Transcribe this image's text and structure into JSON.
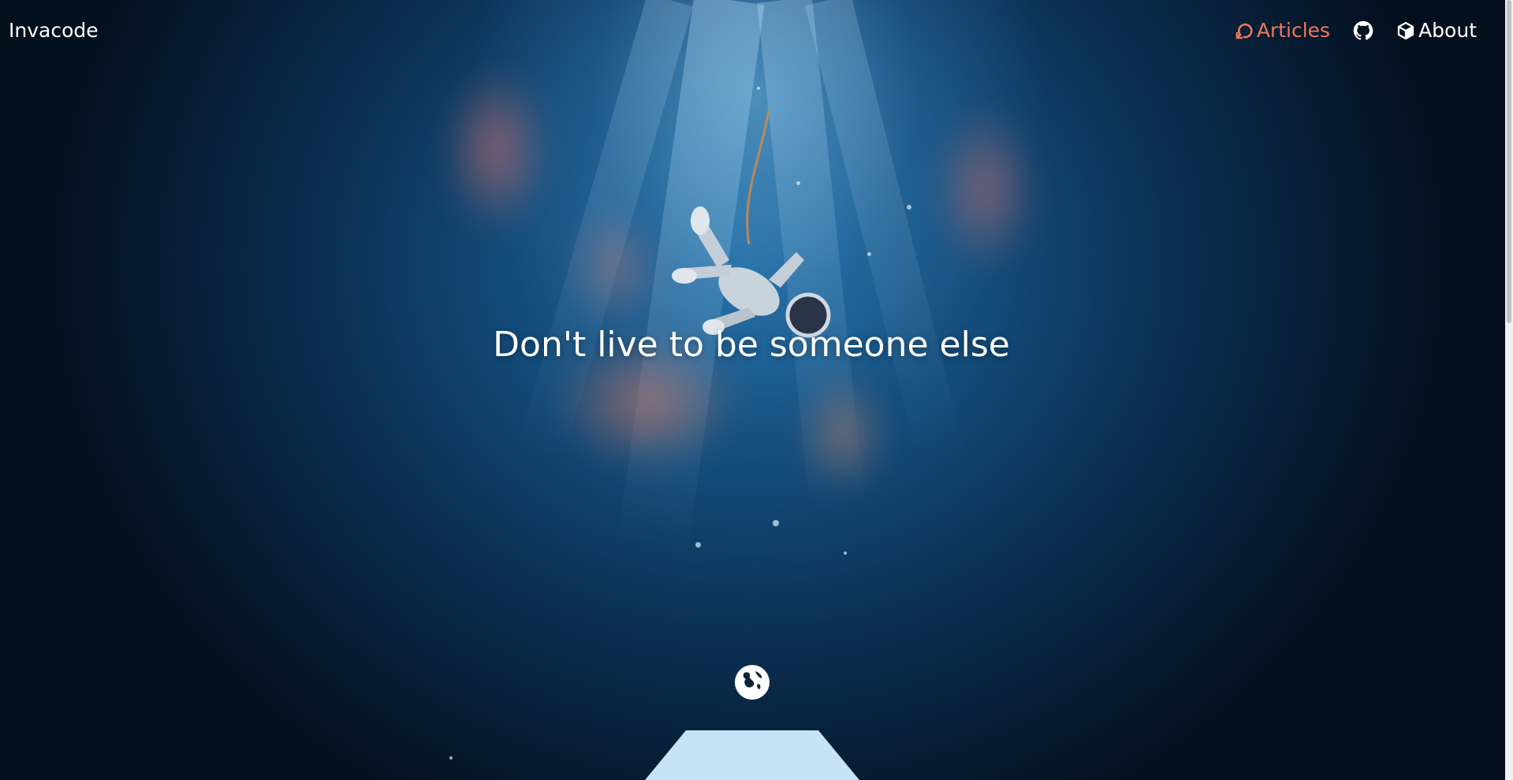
{
  "header": {
    "brand": "Invacode",
    "nav": [
      {
        "label": "Articles",
        "icon": "refresh-icon",
        "active": true
      },
      {
        "label": "",
        "icon": "github-icon",
        "active": false
      },
      {
        "label": "About",
        "icon": "cube-icon",
        "active": false
      }
    ]
  },
  "hero": {
    "headline": "Don't live to be someone else",
    "background": "astronaut-in-nebula-image"
  },
  "footer": {
    "globe_icon": "globe-icon"
  },
  "colors": {
    "accent": "#f0775a",
    "text": "#ffffff",
    "background_dark": "#061426",
    "background_mid": "#1f6aa0"
  }
}
